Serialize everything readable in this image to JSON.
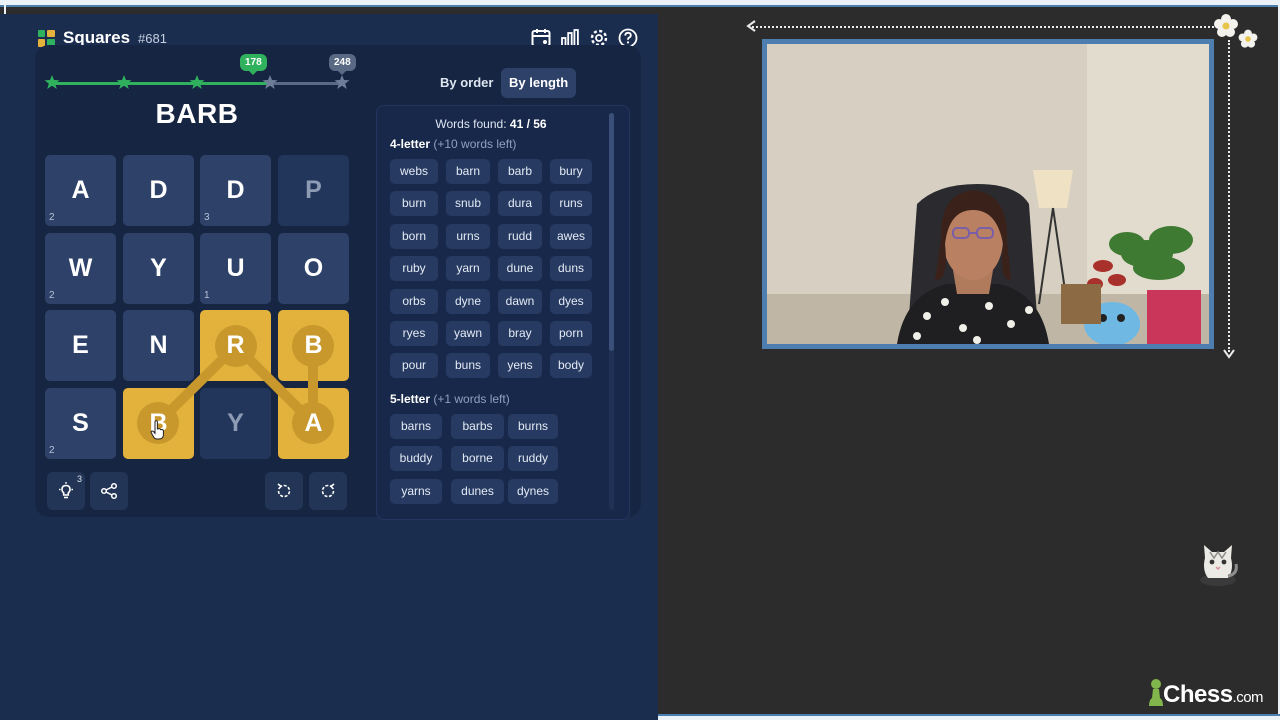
{
  "app": {
    "title": "Squares",
    "puzzle_number": "#681",
    "header_icons": [
      "calendar-icon",
      "stats-icon",
      "settings-icon",
      "help-icon"
    ]
  },
  "progress": {
    "current_score": "178",
    "max_score": "248",
    "stars_reached": 3,
    "stars_total": 5
  },
  "current_word": "BARB",
  "grid": [
    [
      {
        "letter": "A",
        "count": "2"
      },
      {
        "letter": "D",
        "count": ""
      },
      {
        "letter": "D",
        "count": "3"
      },
      {
        "letter": "P",
        "count": ""
      }
    ],
    [
      {
        "letter": "W",
        "count": "2"
      },
      {
        "letter": "Y",
        "count": ""
      },
      {
        "letter": "U",
        "count": "1"
      },
      {
        "letter": "O",
        "count": ""
      }
    ],
    [
      {
        "letter": "E",
        "count": ""
      },
      {
        "letter": "N",
        "count": ""
      },
      {
        "letter": "R",
        "count": ""
      },
      {
        "letter": "B",
        "count": ""
      }
    ],
    [
      {
        "letter": "S",
        "count": "2"
      },
      {
        "letter": "B",
        "count": ""
      },
      {
        "letter": "Y",
        "count": ""
      },
      {
        "letter": "A",
        "count": ""
      }
    ]
  ],
  "tools": {
    "hint_count": "3"
  },
  "tabs": {
    "by_order": "By order",
    "by_length": "By length"
  },
  "words_found": {
    "label": "Words found:",
    "value": "41 / 56"
  },
  "sections": {
    "four": {
      "title": "4-letter",
      "note": "(+10 words left)",
      "words": [
        "webs",
        "barn",
        "barb",
        "bury",
        "burn",
        "snub",
        "dura",
        "runs",
        "born",
        "urns",
        "rudd",
        "awes",
        "ruby",
        "yarn",
        "dune",
        "duns",
        "orbs",
        "dyne",
        "dawn",
        "dyes",
        "ryes",
        "yawn",
        "bray",
        "porn",
        "pour",
        "buns",
        "yens",
        "body"
      ]
    },
    "five": {
      "title": "5-letter",
      "note": "(+1 words left)",
      "words": [
        "barns",
        "barbs",
        "burns",
        "buddy",
        "borne",
        "ruddy",
        "yarns",
        "dunes",
        "dynes"
      ]
    }
  },
  "brand": {
    "name": "Chess",
    "suffix": ".com"
  },
  "colors": {
    "selected_tile": "#e3b23c",
    "progress_green": "#2fb15e",
    "app_bg": "#1b2d4f"
  }
}
